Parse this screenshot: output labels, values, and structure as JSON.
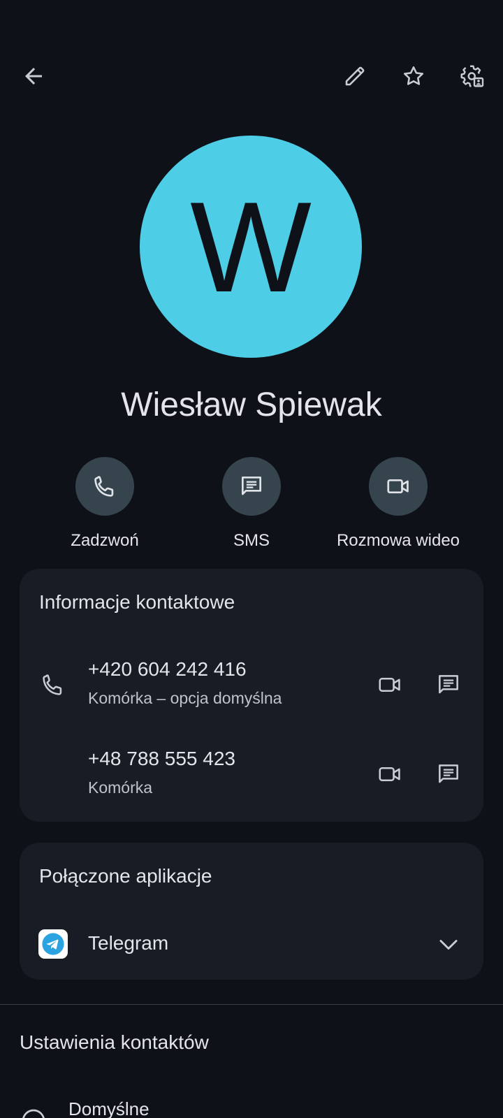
{
  "toolbar": {
    "back_icon": "arrow-back-icon",
    "edit_icon": "pencil-icon",
    "favorite_icon": "star-outline-icon",
    "settings_icon": "contact-settings-icon"
  },
  "contact": {
    "avatar_letter": "W",
    "avatar_color": "#4ecde6",
    "name": "Wiesław Spiewak"
  },
  "actions": [
    {
      "label": "Zadzwoń",
      "icon": "phone-icon"
    },
    {
      "label": "SMS",
      "icon": "message-icon"
    },
    {
      "label": "Rozmowa wideo",
      "icon": "videocam-icon"
    }
  ],
  "contact_info": {
    "title": "Informacje kontaktowe",
    "phones": [
      {
        "number": "+420 604 242 416",
        "label": "Komórka – opcja domyślna"
      },
      {
        "number": "+48 788 555 423",
        "label": "Komórka"
      }
    ]
  },
  "connected_apps": {
    "title": "Połączone aplikacje",
    "apps": [
      {
        "name": "Telegram",
        "icon": "telegram-icon",
        "brand_color": "#2aa3e0"
      }
    ]
  },
  "contact_settings": {
    "title": "Ustawienia kontaktów",
    "items": [
      {
        "label": "Domyślne"
      }
    ]
  },
  "colors": {
    "background": "#0e1218",
    "card": "#181c24",
    "action_circle": "#36444d",
    "text_primary": "#e3e5ea",
    "text_secondary": "#bfc3ca"
  }
}
